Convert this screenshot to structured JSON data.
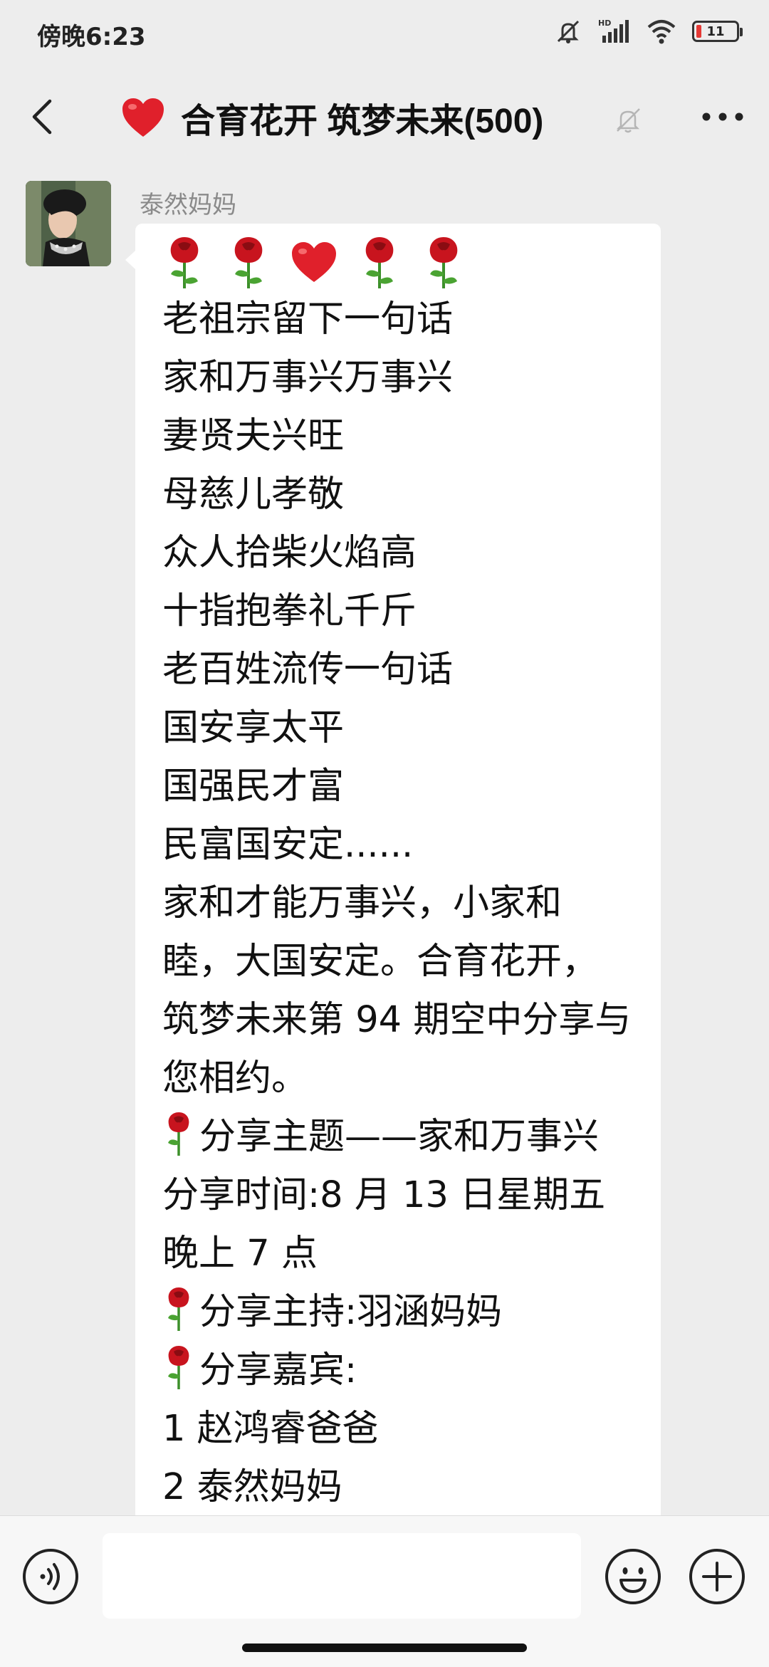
{
  "status_bar": {
    "time": "傍晚6:23",
    "network": "HD",
    "battery_percent": "11"
  },
  "header": {
    "title": "合育花开 筑梦未来(500)",
    "title_emoji": "heart-icon",
    "muted": true
  },
  "message": {
    "sender": "泰然妈妈",
    "emoji_row": [
      "rose",
      "rose",
      "heart",
      "rose",
      "rose"
    ],
    "lines": [
      "老祖宗留下一句话",
      "家和万事兴万事兴",
      "妻贤夫兴旺",
      "母慈儿孝敬",
      "众人拾柴火焰高",
      "十指抱拳礼千斤",
      "老百姓流传一句话",
      "国安享太平",
      "国强民才富",
      "民富国安定......"
    ],
    "paragraph": "家和才能万事兴，小家和睦，大国安定。合育花开，筑梦未来第 94 期空中分享与您相约。",
    "topic": "分享主题——家和万事兴分享时间:8 月 13 日星期五晚上 7 点",
    "host": "分享主持:羽涵妈妈",
    "guests_label": "分享嘉宾:",
    "guests": [
      "1 赵鸿睿爸爸",
      "2 泰然妈妈"
    ]
  },
  "input_bar": {
    "placeholder": ""
  },
  "colors": {
    "background": "#ededed",
    "bubble": "#ffffff",
    "sender_name": "#8a8a8a",
    "battery_low": "#e53935"
  }
}
